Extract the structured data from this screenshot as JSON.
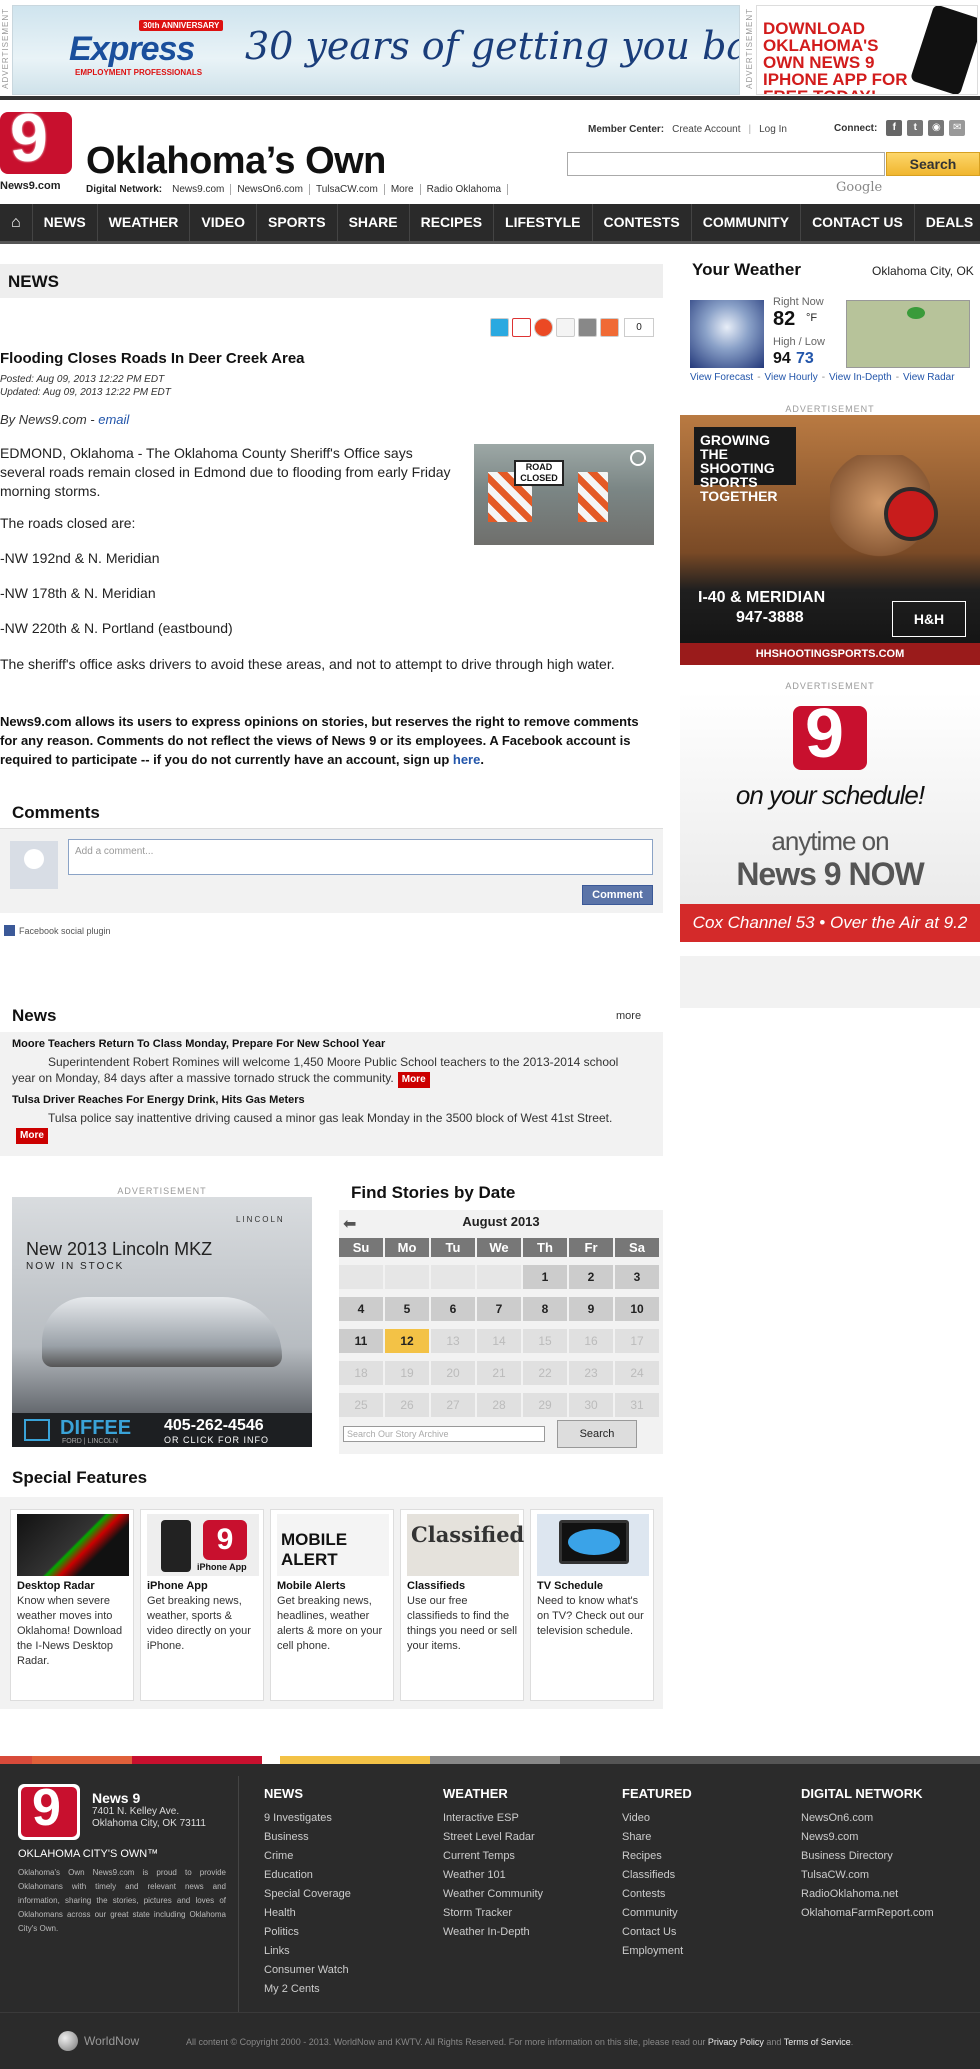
{
  "top_ads": {
    "ad_label": "ADVERTISEMENT",
    "express": {
      "logo": "Express",
      "anniversary": "30th ANNIVERSARY",
      "subtitle": "EMPLOYMENT PROFESSIONALS",
      "slogan": "30 years of getting you back to work."
    },
    "app": {
      "text": "DOWNLOAD OKLAHOMA'S OWN NEWS 9 iPHONE APP FOR FREE TODAY!"
    }
  },
  "header": {
    "logo_digit": "9",
    "logo_sub": "News9.com",
    "title": "Oklahoma’s Own",
    "digital_network_label": "Digital Network:",
    "digital_network_links": [
      "News9.com",
      "NewsOn6.com",
      "TulsaCW.com",
      "More",
      "Radio Oklahoma"
    ],
    "member_center_label": "Member Center:",
    "create_account": "Create Account",
    "log_in": "Log In",
    "connect_label": "Connect:",
    "search_button": "Search",
    "google_label": "Google",
    "accent_color": "#c8102e"
  },
  "nav": {
    "home_icon": "home-icon",
    "items": [
      "NEWS",
      "WEATHER",
      "VIDEO",
      "SPORTS",
      "SHARE",
      "RECIPES",
      "LIFESTYLE",
      "CONTESTS",
      "COMMUNITY",
      "CONTACT US",
      "DEALS"
    ]
  },
  "article": {
    "section": "NEWS",
    "share_count": "0",
    "headline": "Flooding Closes Roads In Deer Creek Area",
    "posted": "Posted: Aug 09, 2013 12:22 PM EDT",
    "updated": "Updated: Aug 09, 2013 12:22 PM EDT",
    "byline_prefix": "By News9.com - ",
    "byline_email": "email",
    "image_sign": "ROAD CLOSED",
    "paragraphs": [
      "EDMOND, Oklahoma - The Oklahoma County Sheriff's Office says several roads remain closed in Edmond due to flooding from early Friday morning storms.",
      "The roads closed are:",
      "-NW 192nd & N. Meridian",
      "-NW 178th & N. Meridian",
      "-NW 220th & N. Portland (eastbound)",
      "The sheriff's office asks drivers to avoid these areas, and not to attempt to drive through high water."
    ],
    "disclaimer": "News9.com allows its users to express opinions on stories, but reserves the right to remove comments for any reason. Comments do not reflect the views of News 9 or its employees. A Facebook account is required to participate -- if you do not currently have an account, sign up ",
    "disclaimer_link": "here",
    "disclaimer_end": "."
  },
  "comments": {
    "title": "Comments",
    "placeholder": "Add a comment...",
    "button": "Comment",
    "plugin": "Facebook social plugin"
  },
  "news_box": {
    "title": "News",
    "more": "more",
    "items": [
      {
        "headline": "Moore Teachers Return To Class Monday, Prepare For New School Year",
        "text": "Superintendent Robert Romines will welcome 1,450 Moore Public School teachers to the 2013-2014 school year on Monday, 84 days after a massive tornado struck the community.",
        "more": "More"
      },
      {
        "headline": "Tulsa Driver Reaches For Energy Drink, Hits Gas Meters",
        "text": "Tulsa police say inattentive driving caused a minor gas leak Monday in the 3500 block of West 41st Street.",
        "more": "More"
      }
    ]
  },
  "lincoln_ad": {
    "label": "ADVERTISEMENT",
    "brand": "LINCOLN",
    "title": "New 2013 Lincoln MKZ",
    "subtitle": "NOW IN STOCK",
    "dealer": "DIFFEE",
    "dealer_sub": "FORD | LINCOLN",
    "phone": "405-262-4546",
    "click": "OR CLICK FOR INFO"
  },
  "calendar": {
    "title": "Find Stories by Date",
    "month": "August 2013",
    "prev_icon": "arrow-left-icon",
    "days_header": [
      "Su",
      "Mo",
      "Tu",
      "We",
      "Th",
      "Fr",
      "Sa"
    ],
    "leading_blanks": 4,
    "days": [
      "1",
      "2",
      "3",
      "4",
      "5",
      "6",
      "7",
      "8",
      "9",
      "10",
      "11",
      "12",
      "13",
      "14",
      "15",
      "16",
      "17",
      "18",
      "19",
      "20",
      "21",
      "22",
      "23",
      "24",
      "25",
      "26",
      "27",
      "28",
      "29",
      "30",
      "31"
    ],
    "today": "12",
    "last_active": "12",
    "search_placeholder": "Search Our Story Archive",
    "search_button": "Search"
  },
  "special_features": {
    "title": "Special Features",
    "items": [
      {
        "name": "Desktop Radar",
        "desc": "Know when severe weather moves into Oklahoma! Download the I-News Desktop Radar."
      },
      {
        "name": "iPhone App",
        "desc": "Get breaking news, weather, sports & video directly on your iPhone.",
        "img_text": "iPhone App"
      },
      {
        "name": "Mobile Alerts",
        "desc": "Get breaking news, headlines, weather alerts & more on your cell phone.",
        "img_text": "MOBILE ALERT"
      },
      {
        "name": "Classifieds",
        "desc": "Use our free classifieds to find the things you need or sell your items.",
        "img_text": "Classified"
      },
      {
        "name": "TV Schedule",
        "desc": "Need to know what's on TV? Check out our television schedule."
      }
    ]
  },
  "weather": {
    "title": "Your Weather",
    "city": "Oklahoma City, OK",
    "right_now_label": "Right Now",
    "temp": "82",
    "unit": "°F",
    "high_low_label": "High / Low",
    "high": "94",
    "low": "73",
    "links": [
      "View Forecast",
      "View Hourly",
      "View In-Depth",
      "View Radar"
    ]
  },
  "side_ads": {
    "label": "ADVERTISEMENT",
    "gun": {
      "headline": "GROWING THE SHOOTING SPORTS TOGETHER",
      "address": "I-40 & MERIDIAN",
      "phone": "947-3888",
      "url": "HHSHOOTINGSPORTS.COM",
      "brand": "H&H"
    },
    "news9now": {
      "digit": "9",
      "line1": "on your schedule!",
      "line2": "anytime on",
      "line3": "News 9 NOW",
      "cox": "Cox Channel 53 • Over the Air at 9.2"
    }
  },
  "footer": {
    "stripe_colors": [
      "#d84a3a",
      "#e0603a",
      "#c8102e",
      "#ffffff",
      "#f3c246",
      "#888888",
      "#555555"
    ],
    "logo_digit": "9",
    "name": "News 9",
    "address1": "7401 N. Kelley Ave.",
    "address2": "Oklahoma City, OK 73111",
    "own": "OKLAHOMA CITY'S OWN™",
    "about": "Oklahoma's Own News9.com is proud to provide Oklahomans with timely and relevant news and information, sharing the stories, pictures and loves of Oklahomans across our great state including Oklahoma City's Own.",
    "columns": [
      {
        "title": "NEWS",
        "links": [
          "9 Investigates",
          "Business",
          "Crime",
          "Education",
          "Special Coverage",
          "Health",
          "Politics",
          "Links",
          "Consumer Watch",
          "My 2 Cents"
        ]
      },
      {
        "title": "WEATHER",
        "links": [
          "Interactive ESP",
          "Street Level Radar",
          "Current Temps",
          "Weather 101",
          "Weather Community",
          "Storm Tracker",
          "Weather In-Depth"
        ]
      },
      {
        "title": "FEATURED",
        "links": [
          "Video",
          "Share",
          "Recipes",
          "Classifieds",
          "Contests",
          "Community",
          "Contact Us",
          "Employment"
        ]
      },
      {
        "title": "DIGITAL NETWORK",
        "links": [
          "NewsOn6.com",
          "News9.com",
          "Business Directory",
          "TulsaCW.com",
          "RadioOklahoma.net",
          "OklahomaFarmReport.com"
        ]
      }
    ],
    "worldnow": "WorldNow",
    "copyright": "All content © Copyright 2000 - 2013. WorldNow and KWTV. All Rights Reserved. For more information on this site, please read our ",
    "privacy": "Privacy Policy",
    "and": " and ",
    "terms": "Terms of Service",
    "period": "."
  }
}
